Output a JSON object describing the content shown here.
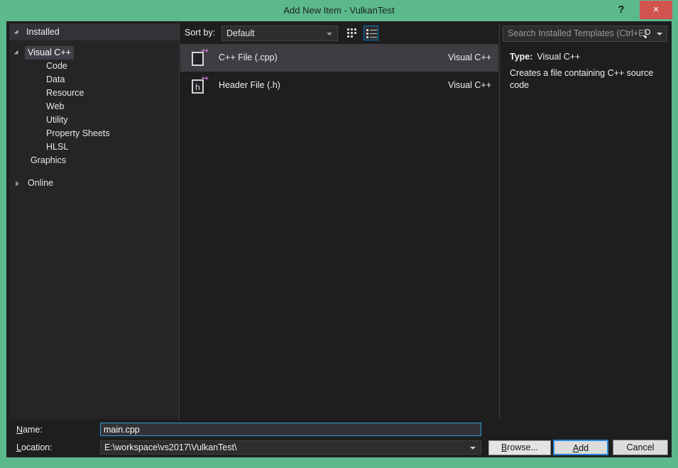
{
  "window": {
    "title": "Add New Item - VulkanTest",
    "help_label": "?",
    "close_label": "×",
    "frame_color": "#5cb98b",
    "close_color": "#d0534f",
    "accent_color": "#007acc"
  },
  "tree": {
    "header": "Installed",
    "nodes": [
      {
        "label": "Visual C++",
        "level": 1,
        "state": "expanded",
        "selected": true
      },
      {
        "label": "Code",
        "level": 2,
        "state": "leaf",
        "selected": false
      },
      {
        "label": "Data",
        "level": 2,
        "state": "leaf",
        "selected": false
      },
      {
        "label": "Resource",
        "level": 2,
        "state": "leaf",
        "selected": false
      },
      {
        "label": "Web",
        "level": 2,
        "state": "leaf",
        "selected": false
      },
      {
        "label": "Utility",
        "level": 2,
        "state": "leaf",
        "selected": false
      },
      {
        "label": "Property Sheets",
        "level": 2,
        "state": "leaf",
        "selected": false
      },
      {
        "label": "HLSL",
        "level": 2,
        "state": "leaf",
        "selected": false
      },
      {
        "label": "Graphics",
        "level": 1,
        "state": "leaf",
        "selected": false
      },
      {
        "label": "Online",
        "level": 1,
        "state": "collapsed",
        "selected": false
      }
    ]
  },
  "toolbar": {
    "sort_label": "Sort by:",
    "sort_value": "Default",
    "grid_view_icon": "medium-icons-view-icon",
    "list_view_icon": "list-view-icon",
    "list_view_active": true
  },
  "templates": {
    "items": [
      {
        "name": "C++ File (.cpp)",
        "origin": "Visual C++",
        "icon": "cpp-file-icon",
        "icon_letter": "",
        "selected": true
      },
      {
        "name": "Header File (.h)",
        "origin": "Visual C++",
        "icon": "header-file-icon",
        "icon_letter": "h",
        "selected": false
      }
    ]
  },
  "search": {
    "placeholder": "Search Installed Templates (Ctrl+E)",
    "value": ""
  },
  "details": {
    "type_key": "Type:",
    "type_value": "Visual C++",
    "description": "Creates a file containing C++ source code"
  },
  "form": {
    "name_label_pre": "N",
    "name_label_post": "ame:",
    "name_value": "main.cpp",
    "location_label_pre": "L",
    "location_label_post": "ocation:",
    "location_value": "E:\\workspace\\vs2017\\VulkanTest\\",
    "browse_pre": "B",
    "browse_post": "rowse..."
  },
  "footer": {
    "add_pre": "A",
    "add_post": "dd",
    "cancel_label": "Cancel"
  }
}
